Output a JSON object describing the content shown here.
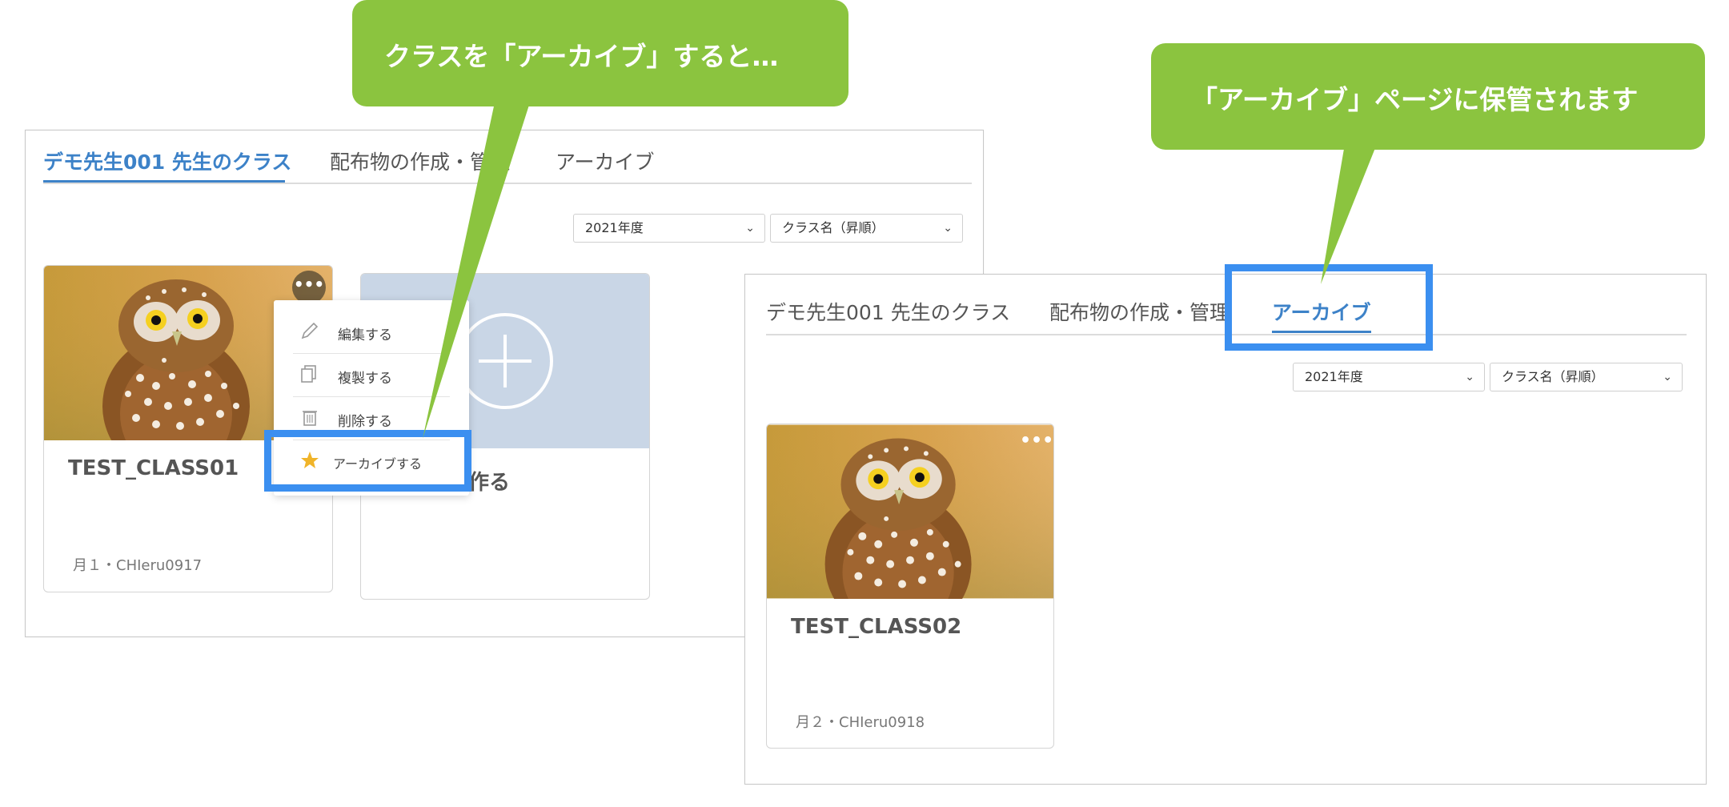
{
  "colors": {
    "accent": "#3d82c8",
    "callout_green": "#8bc43f",
    "highlight_blue": "#3b8ff0",
    "add_card_bg": "#c9d6e6"
  },
  "left_panel": {
    "tabs": [
      "デモ先生001 先生のクラス",
      "配布物の作成・管理",
      "アーカイブ"
    ],
    "active_tab": 0,
    "year_select": "2021年度",
    "sort_select": "クラス名（昇順）",
    "card": {
      "title": "TEST_CLASS01",
      "meta": "月１・CHIeru0917",
      "more_icon": "ellipsis-icon"
    },
    "add_card_label": "作る",
    "add_icon": "plus-circle-icon",
    "menu": [
      {
        "label": "編集する",
        "icon": "pencil-icon"
      },
      {
        "label": "複製する",
        "icon": "copy-icon"
      },
      {
        "label": "削除する",
        "icon": "trash-icon"
      },
      {
        "label": "アーカイブする",
        "icon": "star-icon"
      }
    ]
  },
  "right_panel": {
    "tabs": [
      "デモ先生001 先生のクラス",
      "配布物の作成・管理",
      "アーカイブ"
    ],
    "active_tab": 2,
    "year_select": "2021年度",
    "sort_select": "クラス名（昇順）",
    "card": {
      "title": "TEST_CLASS02",
      "meta": "月２・CHIeru0918",
      "more_icon": "ellipsis-icon"
    }
  },
  "callouts": {
    "left": "クラスを「アーカイブ」すると…",
    "right": "「アーカイブ」ページに保管されます"
  }
}
